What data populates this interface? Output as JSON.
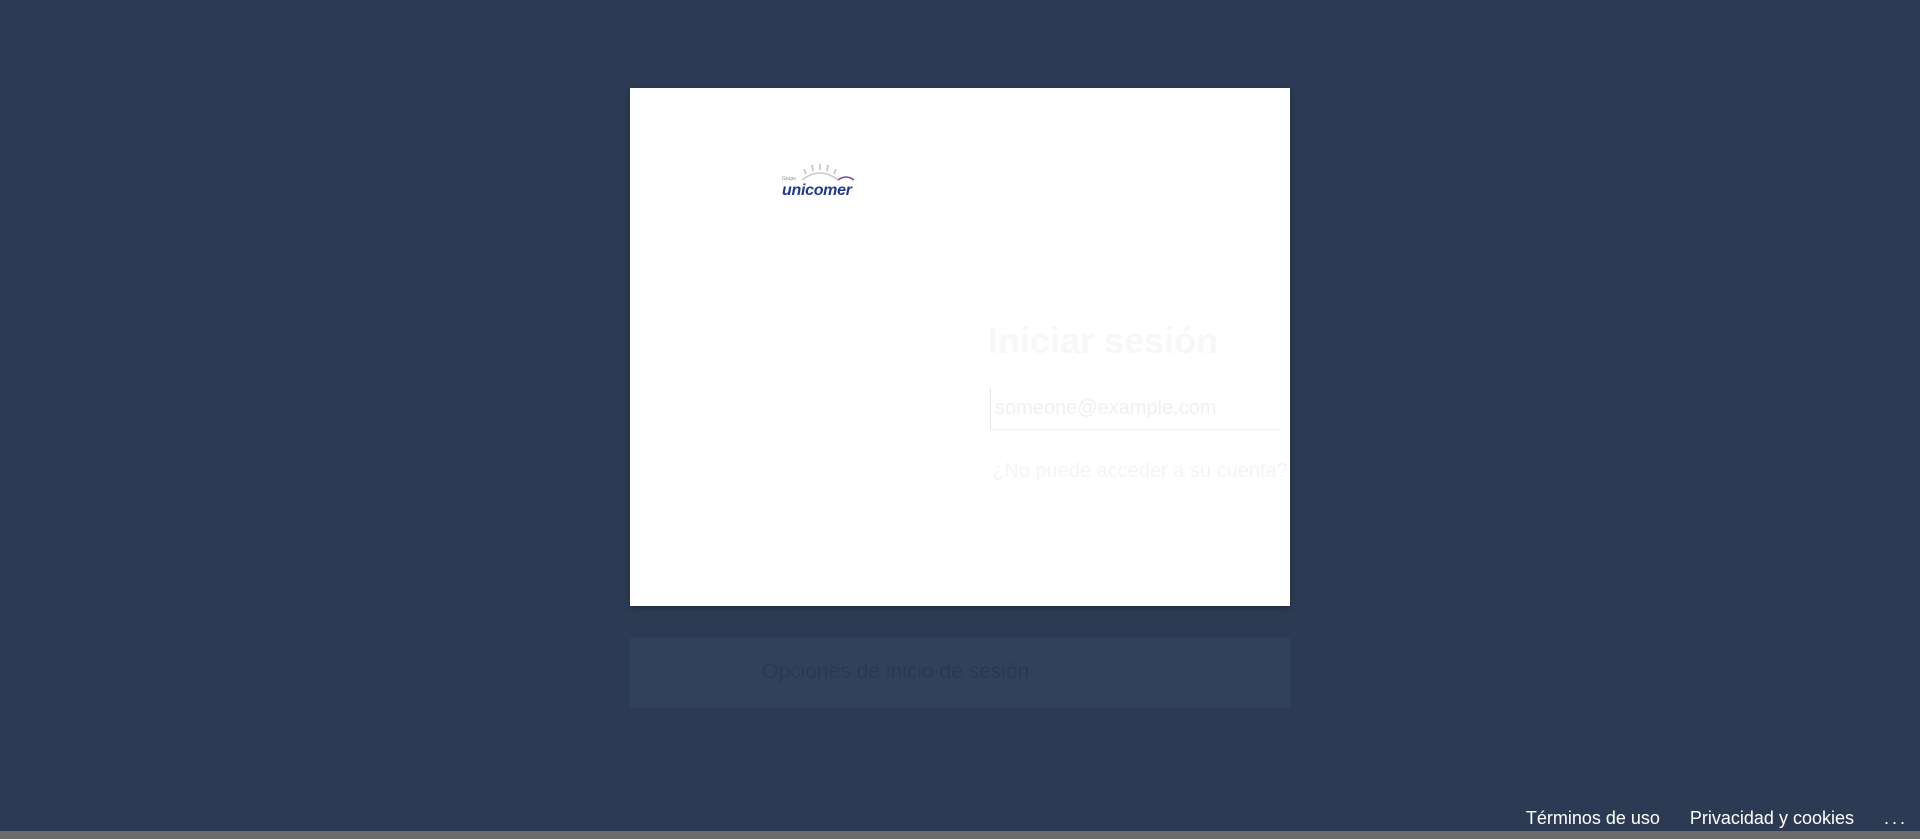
{
  "card": {
    "logo_small": "Grupo",
    "logo_text": "unicomer",
    "title": "Iniciar sesión",
    "email_placeholder": "someone@example.com",
    "cant_access": "¿No puede acceder a su cuenta?"
  },
  "signin_options": {
    "label": "Opciones de inicio de sesión"
  },
  "footer": {
    "terms": "Términos de uso",
    "privacy": "Privacidad y cookies",
    "more": "..."
  },
  "colors": {
    "background": "#2c3b53",
    "card": "#ffffff",
    "logo": "#243a8c"
  }
}
